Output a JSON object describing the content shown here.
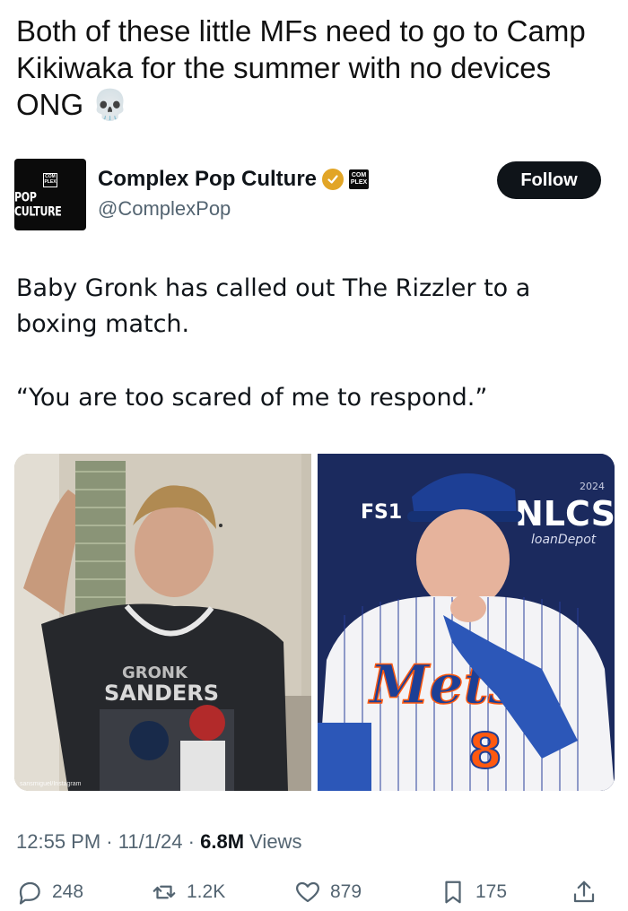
{
  "caption": "Both of these little MFs need to go to Camp Kikiwaka for the summer with no devices ONG",
  "caption_emoji": "💀",
  "account": {
    "avatar_small": "COM PLEX",
    "avatar_text": "POP CULTURE",
    "name": "Complex Pop Culture",
    "affiliate_badge": "COM PLEX",
    "handle": "@ComplexPop",
    "follow_label": "Follow"
  },
  "tweet": {
    "line1": "Baby Gronk has called out The Rizzler to a boxing match.",
    "line2": "“You are too scared of me to respond.”"
  },
  "images": {
    "left_watermark": "sansmiguel/Instagram",
    "left_shirt_top": "GRONK",
    "left_shirt_name": "SANDERS",
    "right_network": "FS1",
    "right_series": "NLCS",
    "right_year": "2024",
    "right_sponsor": "loanDepot",
    "right_jersey": "Mets",
    "right_number": "8"
  },
  "meta": {
    "time": "12:55 PM",
    "date": "11/1/24",
    "views_count": "6.8M",
    "views_label": "Views"
  },
  "actions": {
    "replies": "248",
    "reposts": "1.2K",
    "likes": "879",
    "bookmarks": "175"
  },
  "colors": {
    "follow_bg": "#0f1419",
    "verified": "#e2a526",
    "muted": "#536471",
    "mets_blue": "#1d3f95",
    "mets_orange": "#ff5910"
  }
}
